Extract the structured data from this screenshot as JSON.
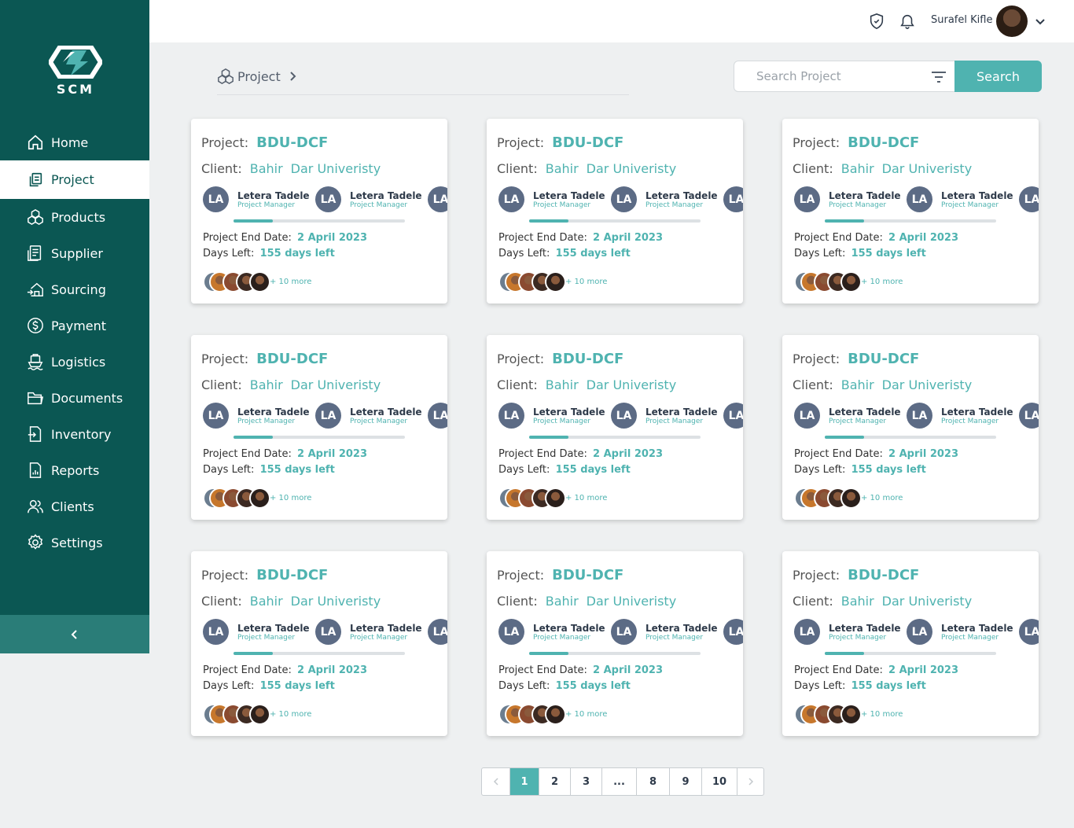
{
  "brand": {
    "name": "SCM"
  },
  "sidebar": {
    "items": [
      {
        "label": "Home",
        "icon": "home-icon",
        "active": false
      },
      {
        "label": "Project",
        "icon": "project-icon",
        "active": true
      },
      {
        "label": "Products",
        "icon": "products-icon",
        "active": false
      },
      {
        "label": "Supplier",
        "icon": "supplier-icon",
        "active": false
      },
      {
        "label": "Sourcing",
        "icon": "sourcing-icon",
        "active": false
      },
      {
        "label": "Payment",
        "icon": "payment-icon",
        "active": false
      },
      {
        "label": "Logistics",
        "icon": "logistics-icon",
        "active": false
      },
      {
        "label": "Documents",
        "icon": "documents-icon",
        "active": false
      },
      {
        "label": "Inventory",
        "icon": "inventory-icon",
        "active": false
      },
      {
        "label": "Reports",
        "icon": "reports-icon",
        "active": false
      },
      {
        "label": "Clients",
        "icon": "clients-icon",
        "active": false
      },
      {
        "label": "Settings",
        "icon": "settings-icon",
        "active": false
      }
    ],
    "collapse_icon": "chevron-left-icon"
  },
  "topbar": {
    "user_name": "Surafel Kifle"
  },
  "breadcrumb": {
    "label": "Project"
  },
  "search": {
    "placeholder": "Search Project",
    "button_label": "Search"
  },
  "card_labels": {
    "project": "Project:",
    "client": "Client:",
    "end_date": "Project End Date:",
    "days_left": "Days Left:"
  },
  "cards": [
    {
      "project": "BDU-DCF",
      "client_a": "Bahir",
      "client_b": "Dar Univeristy",
      "members": [
        {
          "initials": "LA",
          "name": "Letera Tadele",
          "role": "Project Manager"
        },
        {
          "initials": "LA",
          "name": "Letera Tadele",
          "role": "Project Manager"
        },
        {
          "initials": "LA",
          "name": "",
          "role": ""
        }
      ],
      "progress": 0.23,
      "end_date": "2 April 2023",
      "days_left": "155 days left",
      "more": "+ 10 more"
    },
    {
      "project": "BDU-DCF",
      "client_a": "Bahir",
      "client_b": "Dar Univeristy",
      "members": [
        {
          "initials": "LA",
          "name": "Letera Tadele",
          "role": "Project Manager"
        },
        {
          "initials": "LA",
          "name": "Letera Tadele",
          "role": "Project Manager"
        },
        {
          "initials": "LA",
          "name": "",
          "role": ""
        }
      ],
      "progress": 0.23,
      "end_date": "2 April 2023",
      "days_left": "155 days left",
      "more": "+ 10 more"
    },
    {
      "project": "BDU-DCF",
      "client_a": "Bahir",
      "client_b": "Dar Univeristy",
      "members": [
        {
          "initials": "LA",
          "name": "Letera Tadele",
          "role": "Project Manager"
        },
        {
          "initials": "LA",
          "name": "Letera Tadele",
          "role": "Project Manager"
        },
        {
          "initials": "LA",
          "name": "",
          "role": ""
        }
      ],
      "progress": 0.23,
      "end_date": "2 April 2023",
      "days_left": "155 days left",
      "more": "+ 10 more"
    },
    {
      "project": "BDU-DCF",
      "client_a": "Bahir",
      "client_b": "Dar Univeristy",
      "members": [
        {
          "initials": "LA",
          "name": "Letera Tadele",
          "role": "Project Manager"
        },
        {
          "initials": "LA",
          "name": "Letera Tadele",
          "role": "Project Manager"
        },
        {
          "initials": "LA",
          "name": "",
          "role": ""
        }
      ],
      "progress": 0.23,
      "end_date": "2 April 2023",
      "days_left": "155 days left",
      "more": "+ 10 more"
    },
    {
      "project": "BDU-DCF",
      "client_a": "Bahir",
      "client_b": "Dar Univeristy",
      "members": [
        {
          "initials": "LA",
          "name": "Letera Tadele",
          "role": "Project Manager"
        },
        {
          "initials": "LA",
          "name": "Letera Tadele",
          "role": "Project Manager"
        },
        {
          "initials": "LA",
          "name": "",
          "role": ""
        }
      ],
      "progress": 0.23,
      "end_date": "2 April 2023",
      "days_left": "155 days left",
      "more": "+ 10 more"
    },
    {
      "project": "BDU-DCF",
      "client_a": "Bahir",
      "client_b": "Dar Univeristy",
      "members": [
        {
          "initials": "LA",
          "name": "Letera Tadele",
          "role": "Project Manager"
        },
        {
          "initials": "LA",
          "name": "Letera Tadele",
          "role": "Project Manager"
        },
        {
          "initials": "LA",
          "name": "",
          "role": ""
        }
      ],
      "progress": 0.23,
      "end_date": "2 April 2023",
      "days_left": "155 days left",
      "more": "+ 10 more"
    },
    {
      "project": "BDU-DCF",
      "client_a": "Bahir",
      "client_b": "Dar Univeristy",
      "members": [
        {
          "initials": "LA",
          "name": "Letera Tadele",
          "role": "Project Manager"
        },
        {
          "initials": "LA",
          "name": "Letera Tadele",
          "role": "Project Manager"
        },
        {
          "initials": "LA",
          "name": "",
          "role": ""
        }
      ],
      "progress": 0.23,
      "end_date": "2 April 2023",
      "days_left": "155 days left",
      "more": "+ 10 more"
    },
    {
      "project": "BDU-DCF",
      "client_a": "Bahir",
      "client_b": "Dar Univeristy",
      "members": [
        {
          "initials": "LA",
          "name": "Letera Tadele",
          "role": "Project Manager"
        },
        {
          "initials": "LA",
          "name": "Letera Tadele",
          "role": "Project Manager"
        },
        {
          "initials": "LA",
          "name": "",
          "role": ""
        }
      ],
      "progress": 0.23,
      "end_date": "2 April 2023",
      "days_left": "155 days left",
      "more": "+ 10 more"
    },
    {
      "project": "BDU-DCF",
      "client_a": "Bahir",
      "client_b": "Dar Univeristy",
      "members": [
        {
          "initials": "LA",
          "name": "Letera Tadele",
          "role": "Project Manager"
        },
        {
          "initials": "LA",
          "name": "Letera Tadele",
          "role": "Project Manager"
        },
        {
          "initials": "LA",
          "name": "",
          "role": ""
        }
      ],
      "progress": 0.23,
      "end_date": "2 April 2023",
      "days_left": "155 days left",
      "more": "+ 10 more"
    }
  ],
  "pagination": {
    "prev_icon": "chevron-left-icon",
    "next_icon": "chevron-right-icon",
    "pages": [
      "1",
      "2",
      "3",
      "...",
      "8",
      "9",
      "10"
    ],
    "current": "1"
  },
  "colors": {
    "sidebar": "#0b5753",
    "accent": "#4fb3b0",
    "avatar": "#5c6b85"
  }
}
